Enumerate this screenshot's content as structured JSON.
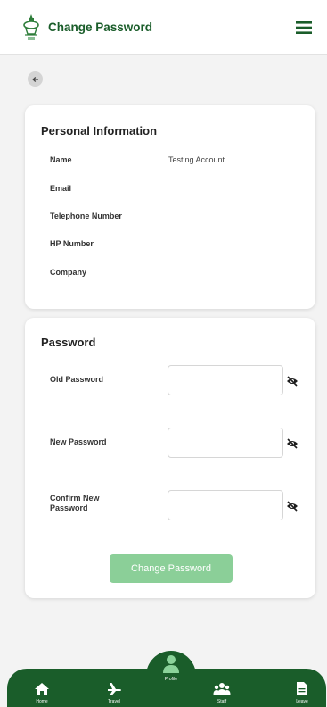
{
  "header": {
    "title": "Change Password",
    "logo_icon": "tower-logo-icon",
    "menu_icon": "hamburger-menu-icon"
  },
  "back": {
    "icon": "arrow-left-icon"
  },
  "personal_info": {
    "title": "Personal Information",
    "fields": [
      {
        "label": "Name",
        "value": "Testing Account"
      },
      {
        "label": "Email",
        "value": ""
      },
      {
        "label": "Telephone Number",
        "value": ""
      },
      {
        "label": "HP Number",
        "value": ""
      },
      {
        "label": "Company",
        "value": ""
      }
    ]
  },
  "password": {
    "title": "Password",
    "old_label": "Old Password",
    "new_label": "New Password",
    "confirm_label": "Confirm New Password",
    "old_value": "",
    "new_value": "",
    "confirm_value": "",
    "eye_icon": "eye-slash-icon",
    "submit_label": "Change Password"
  },
  "nav": {
    "items": [
      {
        "label": "Home",
        "icon": "home-icon"
      },
      {
        "label": "Travel",
        "icon": "airplane-icon"
      },
      {
        "label": "Profile",
        "icon": "user-icon"
      },
      {
        "label": "Staff",
        "icon": "group-icon"
      },
      {
        "label": "Leave",
        "icon": "document-icon"
      }
    ]
  },
  "colors": {
    "brand_green": "#1a5d2a",
    "button_green": "#8bcf98",
    "background": "#f3f3f3",
    "card": "#ffffff"
  }
}
